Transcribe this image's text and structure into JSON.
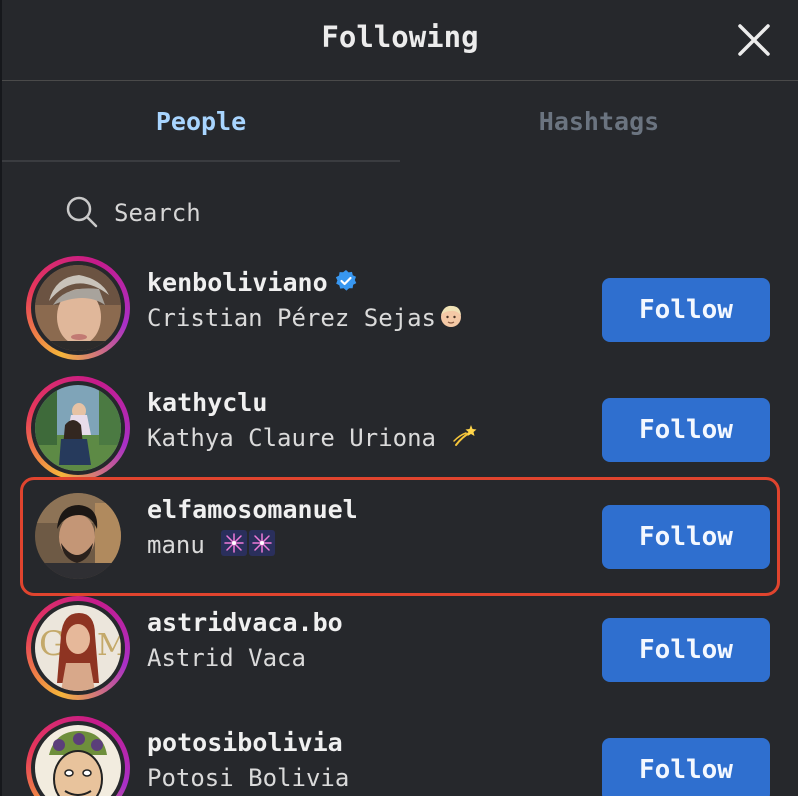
{
  "modal": {
    "title": "Following",
    "close_icon": "close-icon"
  },
  "tabs": [
    {
      "label": "People",
      "active": true
    },
    {
      "label": "Hashtags",
      "active": false
    }
  ],
  "search": {
    "placeholder": "Search",
    "value": ""
  },
  "accounts": [
    {
      "username": "kenboliviano",
      "verified": true,
      "name": "Cristian Pérez Sejas",
      "emoji": "person-emoji",
      "follow_label": "Follow",
      "story_ring": true,
      "highlighted": false
    },
    {
      "username": "kathyclu",
      "verified": false,
      "name": "Kathya Claure Uriona",
      "emoji": "dizzy-star-emoji",
      "follow_label": "Follow",
      "story_ring": true,
      "highlighted": false
    },
    {
      "username": "elfamosomanuel",
      "verified": false,
      "name": "manu",
      "emoji": "fireworks-emoji",
      "follow_label": "Follow",
      "story_ring": false,
      "highlighted": true
    },
    {
      "username": "astridvaca.bo",
      "verified": false,
      "name": "Astrid Vaca",
      "emoji": "",
      "follow_label": "Follow",
      "story_ring": true,
      "highlighted": false
    },
    {
      "username": "potosibolivia",
      "verified": false,
      "name": "Potosi Bolivia",
      "emoji": "",
      "follow_label": "Follow",
      "story_ring": true,
      "highlighted": false
    }
  ],
  "colors": {
    "background": "#26282c",
    "follow_button": "#2f6fcf",
    "active_tab": "#a8d5ff",
    "inactive_tab": "#6b7480",
    "highlight_border": "#e0442e",
    "verified_badge": "#3897f0"
  }
}
